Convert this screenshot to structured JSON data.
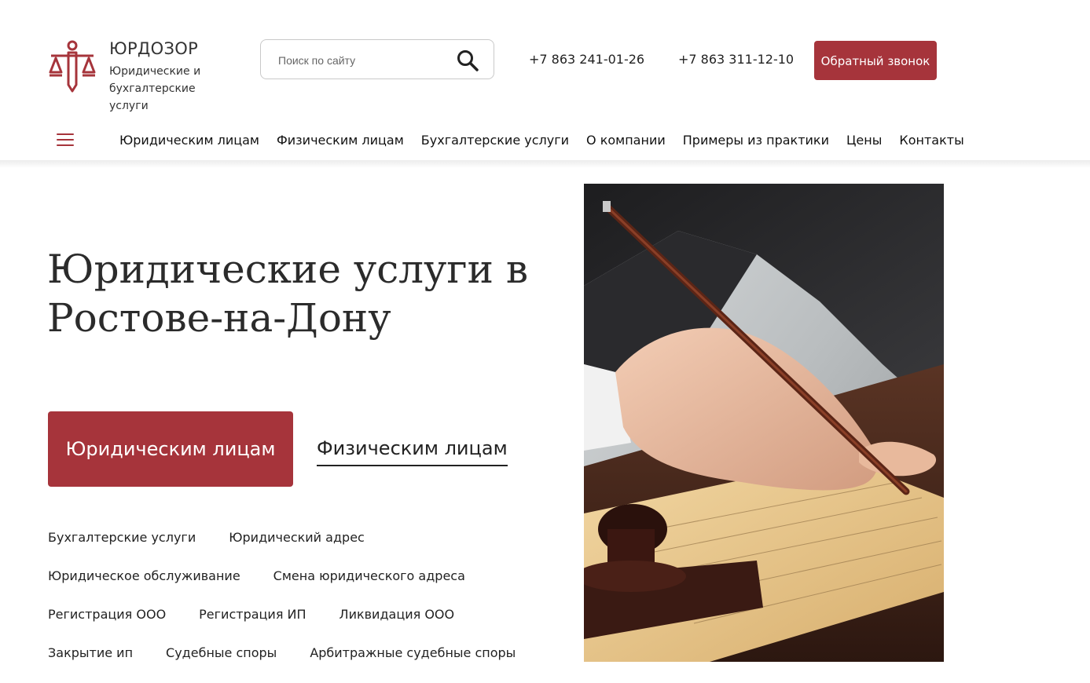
{
  "brand": {
    "name": "ЮРДОЗОР",
    "tagline": "Юридические и бухгалтерские услуги",
    "accent_color": "#a6343b",
    "logo_icon": "scales-of-justice-icon"
  },
  "search": {
    "placeholder": "Поиск по сайту",
    "value": "",
    "icon": "search-icon"
  },
  "contacts": {
    "phone1": "+7 863 241-01-26",
    "phone2": "+7 863 311-12-10",
    "callback_label": "Обратный звонок"
  },
  "nav": {
    "menu_icon": "hamburger-menu-icon",
    "items": [
      {
        "label": "Юридическим лицам"
      },
      {
        "label": "Физическим лицам"
      },
      {
        "label": "Бухгалтерские услуги"
      },
      {
        "label": "О компании"
      },
      {
        "label": "Примеры из практики"
      },
      {
        "label": "Цены"
      },
      {
        "label": "Контакты"
      }
    ]
  },
  "hero": {
    "title": "Юридические услуги в Ростове-на-Дону",
    "primary_button": "Юридическим лицам",
    "secondary_link": "Физическим лицам",
    "image": "hand-writing-with-pen-photo"
  },
  "services": {
    "rows": [
      [
        "Бухгалтерские услуги",
        "Юридический адрес"
      ],
      [
        "Юридическое обслуживание",
        "Смена юридического адреса"
      ],
      [
        "Регистрация ООО",
        "Регистрация ИП",
        "Ликвидация ООО"
      ],
      [
        "Закрытие ип",
        "Судебные споры",
        "Арбитражные судебные споры"
      ]
    ]
  }
}
